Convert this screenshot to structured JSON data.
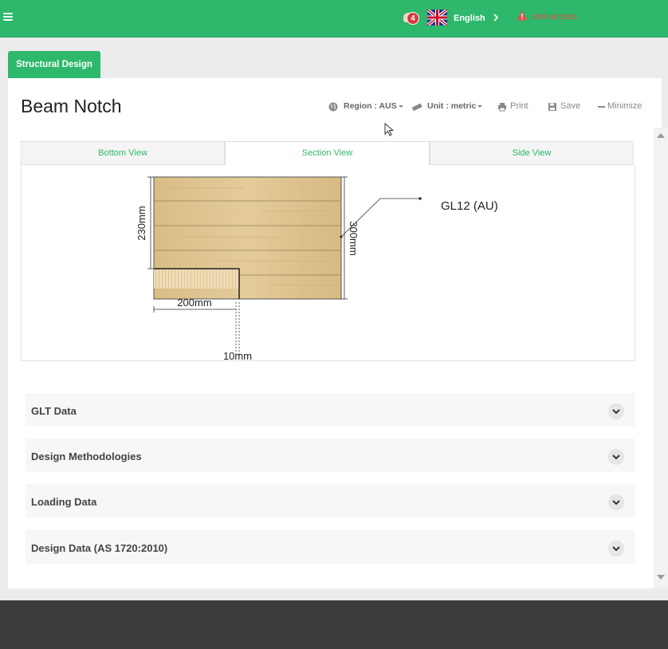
{
  "topbar": {
    "notification_count": "4",
    "language": "English",
    "user": "root-access",
    "colors": {
      "bar": "#2db86b",
      "badge": "#d83a3a",
      "warning": "#e2504a"
    }
  },
  "tabs": {
    "structural": "Structural Design"
  },
  "page": {
    "title": "Beam Notch",
    "toolbar": {
      "region": "Region : AUS",
      "unit": "Unit : metric",
      "print": "Print",
      "save": "Save",
      "minimize": "Minimize"
    }
  },
  "views": {
    "tabs": [
      "Bottom View",
      "Section View",
      "Side View"
    ],
    "selected": "Section View"
  },
  "drawing": {
    "dim_230": "230mm",
    "dim_300": "300mm",
    "dim_200": "200mm",
    "dim_10": "10mm",
    "material": "GL12 (AU)"
  },
  "accordion": [
    {
      "title": "GLT Data"
    },
    {
      "title": "Design Methodologies"
    },
    {
      "title": "Loading Data"
    },
    {
      "title": "Design Data (AS 1720:2010)"
    }
  ]
}
